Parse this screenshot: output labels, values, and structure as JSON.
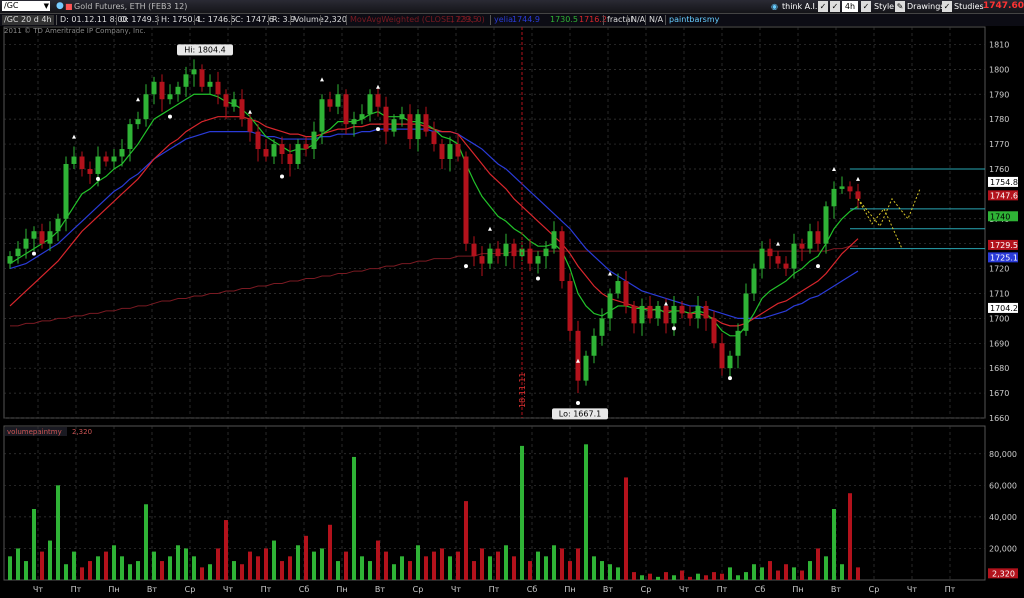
{
  "toolbar": {
    "symbol": "/GC",
    "description": "Gold Futures, ETH (FEB3 12)",
    "think_ai": "think A.I.",
    "timeframe": "4h",
    "style": "Style",
    "drawings": "Drawings",
    "studies": "Studies",
    "last_price": "1747.60"
  },
  "infobar": {
    "period": "/GC 20 d 4h",
    "date": "D: 01.12.11 8:00",
    "open": "O: 1749.3",
    "high": "H: 1750.4",
    "low": "L: 1746.5",
    "close": "C: 1747.6",
    "range": "R: 3.9",
    "volume_label": "Volume",
    "volume_value": "2,320",
    "study1": "MovAvgWeighted (CLOSE, 233, 0)",
    "study1_val": "1729.5",
    "study2": "yelia",
    "study2_val": "1744.9",
    "study3_val": "1730.5",
    "study4_val": "1716.2",
    "fractal": "fractal",
    "na1": "N/A",
    "na2": "N/A",
    "paintbars": "paintbarsmy"
  },
  "copyright": "2011 © TD Ameritrade IP Company, Inc.",
  "volume_header": {
    "name": "volumepaintmy",
    "value": "2,320"
  },
  "colors": {
    "up": "#2fb336",
    "down": "#b3121c",
    "ema_fast": "#22c22a",
    "ema_mid": "#d8262c",
    "ema_slow": "#2a3bd8",
    "ma_long": "#7a1a22",
    "cyan": "#29a7b5",
    "fractal_dash": "#d6c52a",
    "background": "#000000",
    "grid": "#3a3a3a"
  },
  "chart_data": [
    {
      "type": "candlestick",
      "title": "",
      "y_range": [
        1660,
        1815
      ],
      "y_ticks": [
        1660,
        1670,
        1680,
        1690,
        1700,
        1710,
        1720,
        1730,
        1740,
        1750,
        1760,
        1770,
        1780,
        1790,
        1800,
        1810
      ],
      "x_tick_labels": [
        "Чт",
        "Пт",
        "Пн",
        "Вт",
        "Ср",
        "Чт",
        "Пт",
        "Сб",
        "Пн",
        "Вт",
        "Ср",
        "Чт",
        "Пт",
        "Сб",
        "Пн",
        "Вт",
        "Ср",
        "Чт",
        "Пт",
        "Сб",
        "Пн",
        "Вт",
        "Ср",
        "Чт",
        "Пт",
        "Сб",
        "Вт"
      ],
      "closes": [
        1725,
        1728,
        1732,
        1735,
        1730,
        1735,
        1740,
        1762,
        1765,
        1760,
        1758,
        1765,
        1763,
        1765,
        1768,
        1778,
        1780,
        1790,
        1795,
        1788,
        1790,
        1793,
        1798,
        1800,
        1793,
        1795,
        1790,
        1785,
        1788,
        1780,
        1775,
        1768,
        1765,
        1770,
        1766,
        1762,
        1770,
        1768,
        1775,
        1788,
        1785,
        1790,
        1778,
        1780,
        1782,
        1790,
        1785,
        1775,
        1780,
        1782,
        1772,
        1782,
        1775,
        1770,
        1764,
        1770,
        1765,
        1730,
        1725,
        1722,
        1728,
        1725,
        1730,
        1725,
        1728,
        1722,
        1725,
        1728,
        1735,
        1715,
        1695,
        1675,
        1685,
        1693,
        1700,
        1710,
        1715,
        1705,
        1698,
        1705,
        1700,
        1705,
        1698,
        1705,
        1702,
        1700,
        1705,
        1700,
        1690,
        1680,
        1685,
        1695,
        1710,
        1720,
        1728,
        1725,
        1722,
        1720,
        1730,
        1728,
        1735,
        1730,
        1745,
        1752,
        1753,
        1751,
        1748
      ],
      "ema_fast": [
        1722,
        1724,
        1726,
        1728,
        1730,
        1732,
        1735,
        1740,
        1745,
        1750,
        1752,
        1755,
        1757,
        1760,
        1762,
        1766,
        1770,
        1775,
        1780,
        1782,
        1784,
        1786,
        1788,
        1790,
        1790,
        1790,
        1789,
        1787,
        1786,
        1784,
        1781,
        1777,
        1773,
        1771,
        1769,
        1767,
        1768,
        1768,
        1770,
        1774,
        1776,
        1779,
        1779,
        1779,
        1780,
        1782,
        1783,
        1781,
        1781,
        1781,
        1779,
        1779,
        1778,
        1776,
        1773,
        1772,
        1770,
        1762,
        1755,
        1749,
        1745,
        1741,
        1739,
        1736,
        1734,
        1731,
        1729,
        1729,
        1730,
        1727,
        1720,
        1710,
        1705,
        1702,
        1701,
        1703,
        1705,
        1705,
        1704,
        1704,
        1703,
        1704,
        1702,
        1703,
        1703,
        1702,
        1703,
        1702,
        1699,
        1695,
        1693,
        1693,
        1697,
        1702,
        1708,
        1711,
        1713,
        1715,
        1718,
        1720,
        1723,
        1725,
        1730,
        1736,
        1740,
        1743,
        1745
      ],
      "ema_mid": [
        1705,
        1708,
        1711,
        1714,
        1717,
        1720,
        1723,
        1727,
        1731,
        1735,
        1738,
        1741,
        1744,
        1747,
        1750,
        1753,
        1756,
        1760,
        1764,
        1767,
        1770,
        1772,
        1775,
        1777,
        1779,
        1780,
        1781,
        1781,
        1781,
        1781,
        1780,
        1779,
        1777,
        1776,
        1775,
        1774,
        1774,
        1773,
        1773,
        1774,
        1775,
        1776,
        1776,
        1777,
        1777,
        1778,
        1778,
        1778,
        1778,
        1778,
        1778,
        1778,
        1777,
        1776,
        1775,
        1775,
        1774,
        1770,
        1766,
        1762,
        1758,
        1755,
        1752,
        1748,
        1745,
        1742,
        1739,
        1736,
        1733,
        1730,
        1726,
        1721,
        1717,
        1713,
        1710,
        1708,
        1707,
        1706,
        1705,
        1704,
        1704,
        1703,
        1703,
        1703,
        1703,
        1702,
        1702,
        1701,
        1700,
        1698,
        1697,
        1697,
        1698,
        1700,
        1702,
        1704,
        1706,
        1707,
        1709,
        1711,
        1713,
        1715,
        1718,
        1722,
        1726,
        1729,
        1732
      ],
      "ema_slow": [
        1720,
        1721,
        1722,
        1724,
        1726,
        1728,
        1730,
        1733,
        1736,
        1739,
        1742,
        1745,
        1748,
        1751,
        1753,
        1756,
        1758,
        1761,
        1764,
        1766,
        1768,
        1770,
        1772,
        1773,
        1774,
        1775,
        1775,
        1775,
        1775,
        1775,
        1775,
        1774,
        1773,
        1773,
        1772,
        1772,
        1772,
        1772,
        1772,
        1773,
        1773,
        1774,
        1774,
        1774,
        1775,
        1775,
        1776,
        1776,
        1776,
        1776,
        1776,
        1776,
        1776,
        1775,
        1775,
        1775,
        1774,
        1772,
        1770,
        1768,
        1765,
        1762,
        1760,
        1757,
        1754,
        1751,
        1748,
        1745,
        1742,
        1739,
        1736,
        1732,
        1728,
        1725,
        1722,
        1719,
        1717,
        1715,
        1713,
        1711,
        1710,
        1709,
        1708,
        1707,
        1706,
        1705,
        1705,
        1704,
        1703,
        1702,
        1701,
        1700,
        1700,
        1700,
        1700,
        1701,
        1702,
        1703,
        1705,
        1706,
        1708,
        1709,
        1711,
        1713,
        1715,
        1717,
        1719
      ],
      "ma_long": [
        1697,
        1697,
        1698,
        1698,
        1699,
        1699,
        1700,
        1700,
        1701,
        1701,
        1702,
        1702,
        1703,
        1703,
        1704,
        1704,
        1705,
        1705,
        1706,
        1707,
        1707,
        1708,
        1708,
        1709,
        1709,
        1710,
        1710,
        1711,
        1711,
        1712,
        1712,
        1713,
        1713,
        1714,
        1714,
        1715,
        1715,
        1716,
        1716,
        1717,
        1717,
        1718,
        1718,
        1719,
        1719,
        1720,
        1720,
        1721,
        1721,
        1722,
        1722,
        1723,
        1723,
        1724,
        1724,
        1724,
        1725,
        1725,
        1725,
        1726,
        1726,
        1726,
        1726,
        1727,
        1727,
        1727,
        1727,
        1727,
        1727,
        1727,
        1727,
        1727,
        1727,
        1727,
        1727,
        1727,
        1727,
        1727,
        1727,
        1727,
        1727,
        1727,
        1727,
        1727,
        1727,
        1727,
        1727,
        1727,
        1727,
        1727,
        1727,
        1727,
        1727,
        1727,
        1727,
        1727,
        1727,
        1727,
        1727,
        1727,
        1727,
        1727,
        1727,
        1728,
        1728,
        1729,
        1729
      ],
      "fractal_highs": [
        8,
        16,
        23,
        30,
        39,
        46,
        60,
        71,
        75,
        82,
        96,
        103,
        106
      ],
      "fractal_lows": [
        3,
        11,
        20,
        34,
        46,
        57,
        66,
        71,
        83,
        90,
        101
      ],
      "hi_label": "Hi: 1804.4",
      "lo_label": "Lo: 1667.1",
      "date_marker": "18.11.11",
      "horizontal_levels": [
        1760,
        1744,
        1736,
        1728
      ],
      "price_labels": [
        {
          "text": "1754.8",
          "value": 1754.8,
          "bg": "#ffffff",
          "fg": "#000000"
        },
        {
          "text": "1747.6",
          "value": 1749.4,
          "bg": "#b3121c",
          "fg": "#ffffff"
        },
        {
          "text": "1740",
          "value": 1741,
          "bg": "#2fb336",
          "fg": "#000000"
        },
        {
          "text": "1729.5",
          "value": 1729.5,
          "bg": "#b3121c",
          "fg": "#ffffff"
        },
        {
          "text": "1725.1",
          "value": 1724.5,
          "bg": "#2a3bd8",
          "fg": "#ffffff"
        },
        {
          "text": "1704.2",
          "value": 1704.2,
          "bg": "#ffffff",
          "fg": "#000000"
        }
      ]
    },
    {
      "type": "bar",
      "title": "",
      "y_range": [
        0,
        90000
      ],
      "y_ticks": [
        20000,
        40000,
        60000,
        80000
      ],
      "y_tick_labels": [
        "20,000",
        "40,000",
        "60,000",
        "80,000"
      ],
      "last_label": "2,320",
      "values": [
        15000,
        20000,
        12000,
        45000,
        18000,
        25000,
        60000,
        10000,
        18000,
        8000,
        12000,
        15000,
        18000,
        22000,
        15000,
        10000,
        12000,
        48000,
        18000,
        12000,
        15000,
        22000,
        20000,
        15000,
        8000,
        10000,
        20000,
        38000,
        12000,
        10000,
        18000,
        15000,
        20000,
        25000,
        12000,
        15000,
        22000,
        28000,
        18000,
        20000,
        35000,
        12000,
        18000,
        78000,
        15000,
        12000,
        25000,
        18000,
        10000,
        15000,
        12000,
        22000,
        15000,
        18000,
        20000,
        15000,
        18000,
        50000,
        12000,
        20000,
        15000,
        18000,
        22000,
        15000,
        85000,
        12000,
        18000,
        15000,
        22000,
        20000,
        12000,
        20000,
        86000,
        15000,
        12000,
        10000,
        8000,
        65000,
        5000,
        3000,
        4000,
        2000,
        5000,
        3000,
        6000,
        2000,
        4000,
        3000,
        5000,
        4000,
        8000,
        3000,
        5000,
        10000,
        8000,
        12000,
        6000,
        10000,
        8000,
        6000,
        12000,
        20000,
        15000,
        45000,
        10000,
        55000,
        8000,
        5000
      ]
    }
  ]
}
